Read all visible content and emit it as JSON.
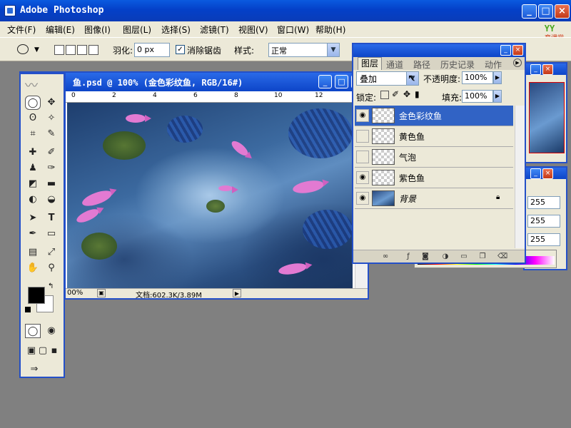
{
  "app": {
    "title": "Adobe Photoshop",
    "brand": "YY",
    "brand_sub": "育课堂"
  },
  "window_buttons": {
    "minimize": "_",
    "maximize": "□",
    "close": "×"
  },
  "menu": [
    "文件(F)",
    "编辑(E)",
    "图像(I)",
    "图层(L)",
    "选择(S)",
    "滤镜(T)",
    "视图(V)",
    "窗口(W)",
    "帮助(H)"
  ],
  "options": {
    "feather_label": "羽化:",
    "feather_value": "0 px",
    "antialias_label": "消除锯齿",
    "antialias_checked": true,
    "style_label": "样式:",
    "style_value": "正常"
  },
  "document": {
    "title": "鱼.psd @ 100% (金色彩纹鱼, RGB/16#)",
    "ruler_ticks": [
      "0",
      "2",
      "4",
      "6",
      "8",
      "10",
      "12"
    ],
    "zoom": "00%",
    "doc_info": "文档:602.3K/3.89M"
  },
  "layers_panel": {
    "tabs": [
      "图层",
      "通道",
      "路径",
      "历史记录",
      "动作"
    ],
    "blend_mode": "叠加",
    "opacity_label": "不透明度:",
    "opacity_value": "100%",
    "lock_label": "锁定:",
    "fill_label": "填充:",
    "fill_value": "100%",
    "layers": [
      {
        "name": "金色彩纹鱼",
        "visible": true,
        "selected": true,
        "locked": false
      },
      {
        "name": "黄色鱼",
        "visible": false,
        "selected": false,
        "locked": false
      },
      {
        "name": "气泡",
        "visible": false,
        "selected": false,
        "locked": false
      },
      {
        "name": "紫色鱼",
        "visible": true,
        "selected": false,
        "locked": false
      },
      {
        "name": "背景",
        "visible": true,
        "selected": false,
        "locked": true
      }
    ]
  },
  "color_panel": {
    "values": [
      "255",
      "255",
      "255"
    ]
  },
  "colors": {
    "title_blue": "#0a5ae0",
    "panel_bg": "#ece9d8",
    "selected_row": "#3163c5",
    "desktop": "#808080"
  }
}
